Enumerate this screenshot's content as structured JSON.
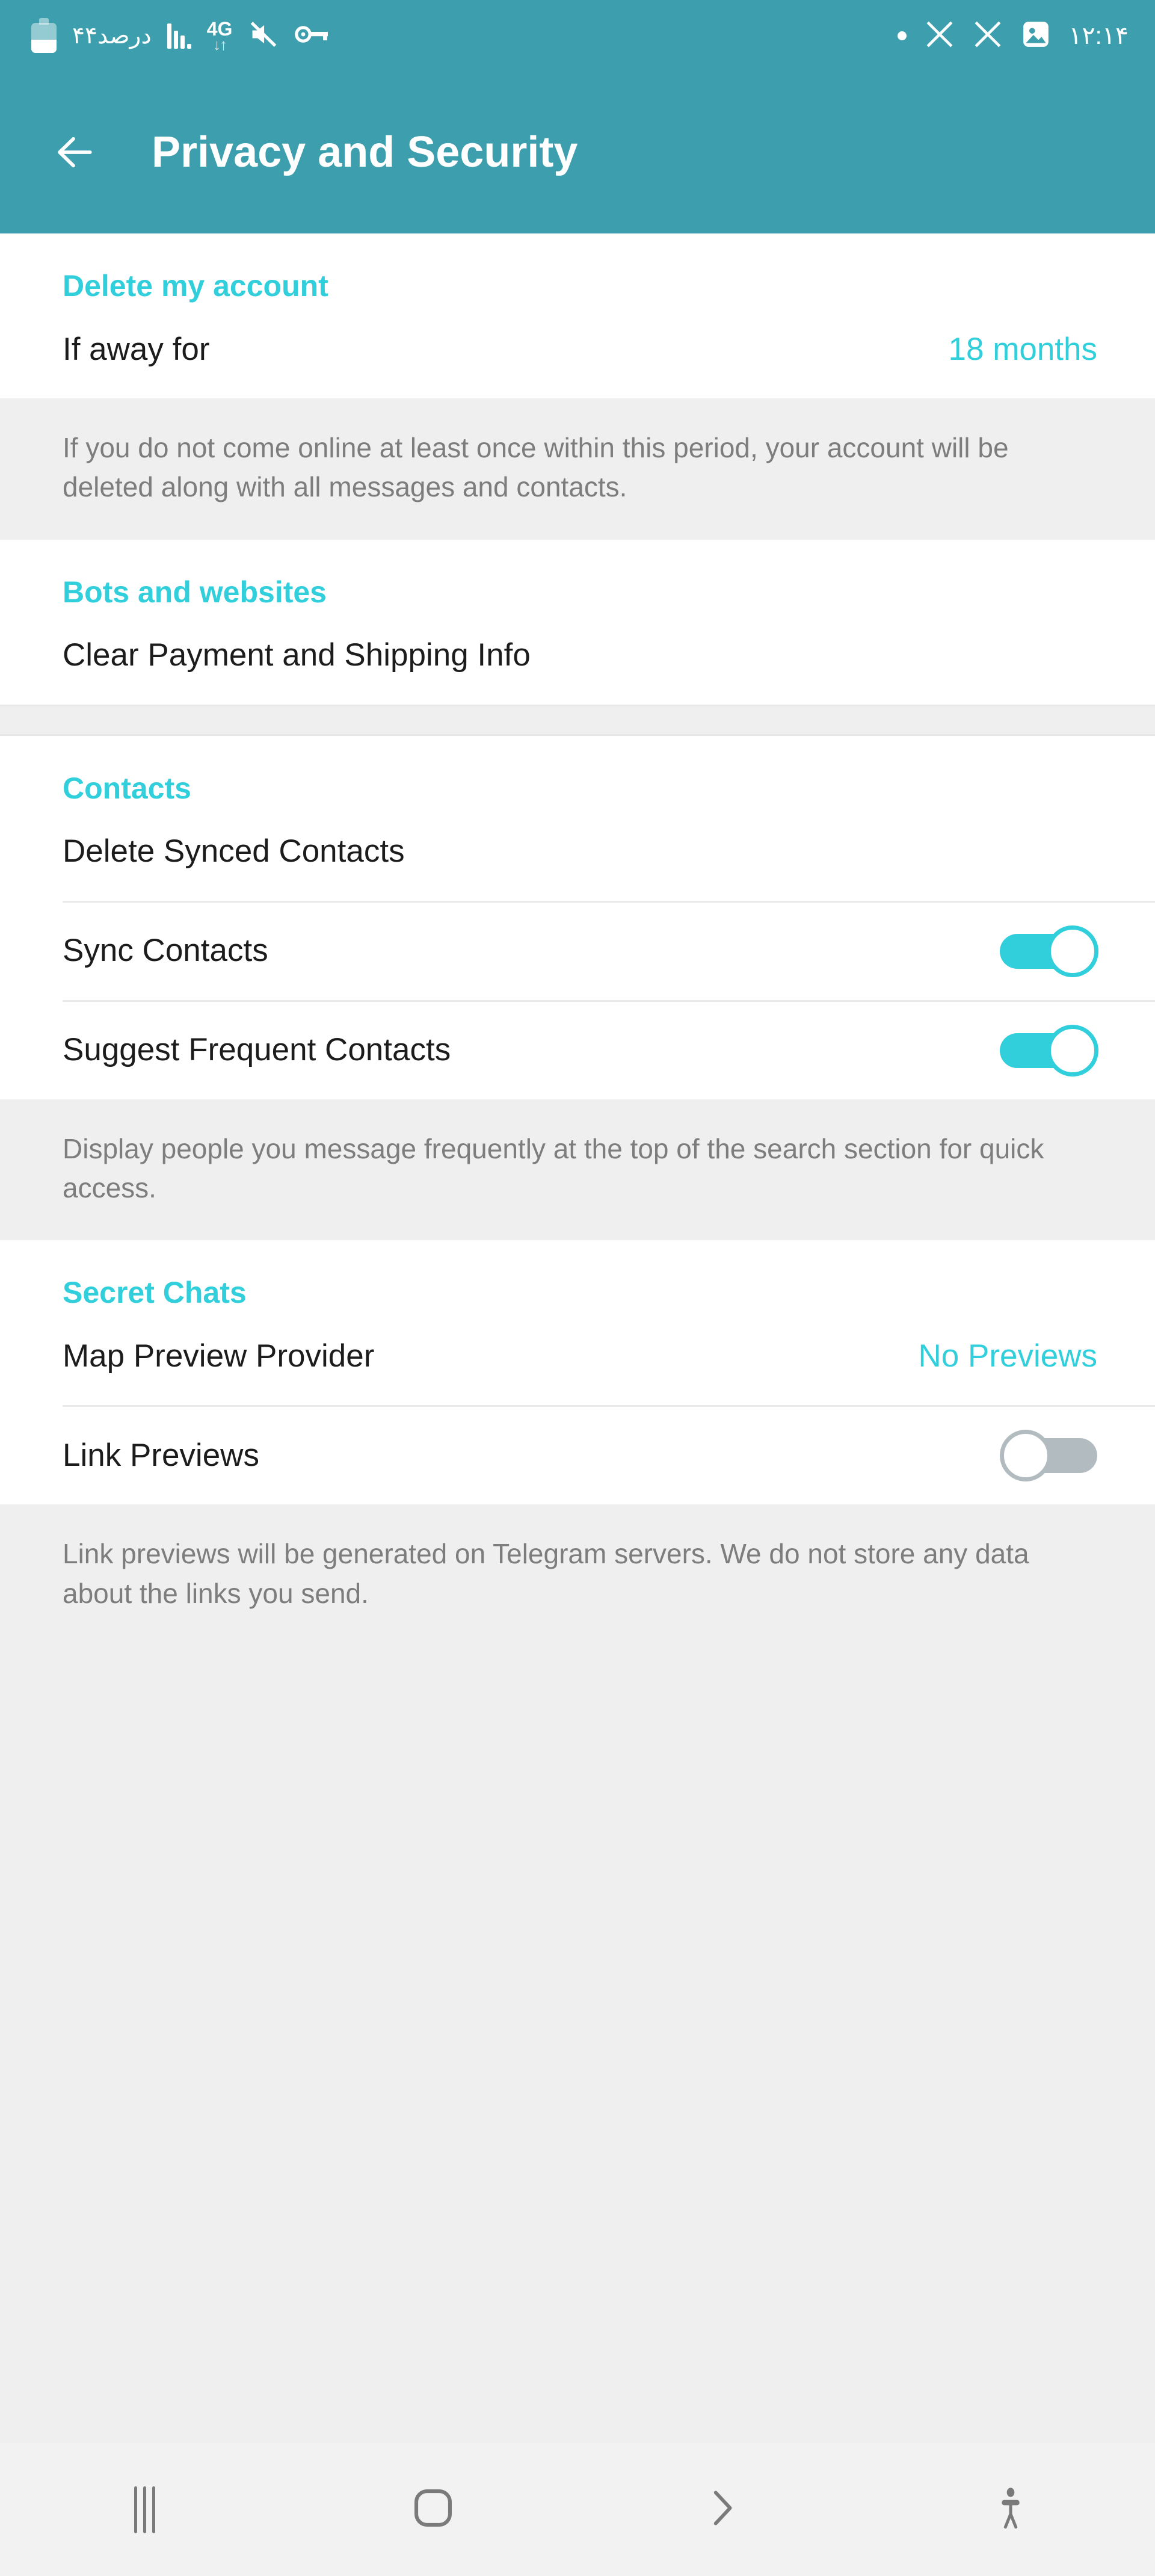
{
  "status_bar": {
    "battery_label": "۴۴درصد",
    "battery_percent": 44,
    "network_type": "4G",
    "time": "۱۲:۱۴",
    "icons_left": [
      "battery-icon",
      "signal-bars-icon",
      "network-4g-icon",
      "mute-icon",
      "vpn-key-icon"
    ],
    "icons_right": [
      "dot-icon",
      "x-app-icon",
      "x-app-icon",
      "image-icon"
    ]
  },
  "app_bar": {
    "title": "Privacy and Security",
    "back_icon": "back-arrow-icon",
    "background": "#3d9fad"
  },
  "colors": {
    "accent": "#31cedb",
    "header_bg": "#3d9fad",
    "note_bg": "#efefef",
    "note_text": "#7d7d7d",
    "row_text": "#1c1c1c",
    "toggle_off": "#b2bcc0"
  },
  "sections": [
    {
      "header": "Delete my account",
      "rows": [
        {
          "label": "If away for",
          "value": "18 months",
          "type": "value"
        }
      ],
      "note": "If you do not come online at least once within this period, your account will be deleted along with all messages and contacts."
    },
    {
      "header": "Bots and websites",
      "rows": [
        {
          "label": "Clear Payment and Shipping Info",
          "type": "action"
        }
      ]
    },
    {
      "header": "Contacts",
      "rows": [
        {
          "label": "Delete Synced Contacts",
          "type": "action"
        },
        {
          "label": "Sync Contacts",
          "type": "toggle",
          "toggle_state": "on"
        },
        {
          "label": "Suggest Frequent Contacts",
          "type": "toggle",
          "toggle_state": "on"
        }
      ],
      "note": "Display people you message frequently at the top of the search section for quick access."
    },
    {
      "header": "Secret Chats",
      "rows": [
        {
          "label": "Map Preview Provider",
          "value": "No Previews",
          "type": "value"
        },
        {
          "label": "Link Previews",
          "type": "toggle",
          "toggle_state": "off"
        }
      ],
      "note": "Link previews will be generated on Telegram servers. We do not store any data about the links you send."
    }
  ],
  "nav_bar": {
    "buttons": [
      {
        "name": "recents-button",
        "icon": "recents-icon"
      },
      {
        "name": "home-button",
        "icon": "home-icon"
      },
      {
        "name": "back-button",
        "icon": "chevron-right-icon"
      },
      {
        "name": "accessibility-button",
        "icon": "accessibility-icon"
      }
    ]
  }
}
